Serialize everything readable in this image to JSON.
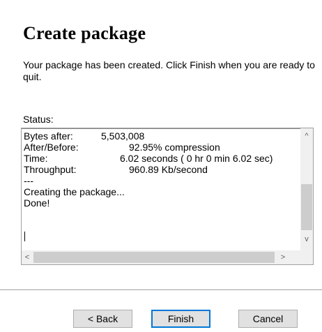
{
  "page": {
    "title": "Create package",
    "intro": "Your package has been created.  Click Finish when you are ready to quit.",
    "status_label": "Status:"
  },
  "status_lines": [
    {
      "label": "Bytes after:",
      "value": "5,503,008"
    },
    {
      "label": "After/Before:",
      "value": "92.95% compression"
    },
    {
      "label": "Time:",
      "value": "6.02 seconds ( 0 hr  0 min  6.02 sec)"
    },
    {
      "label": "Throughput:",
      "value": "960.89 Kb/second"
    },
    {
      "label": "---",
      "value": ""
    },
    {
      "label": "Creating the package...",
      "value": ""
    },
    {
      "label": "Done!",
      "value": ""
    }
  ],
  "scrollbars": {
    "up_arrow": "^",
    "down_arrow": "v",
    "left_arrow": "<",
    "right_arrow": ">"
  },
  "buttons": {
    "back": "< Back",
    "finish": "Finish",
    "cancel": "Cancel"
  }
}
